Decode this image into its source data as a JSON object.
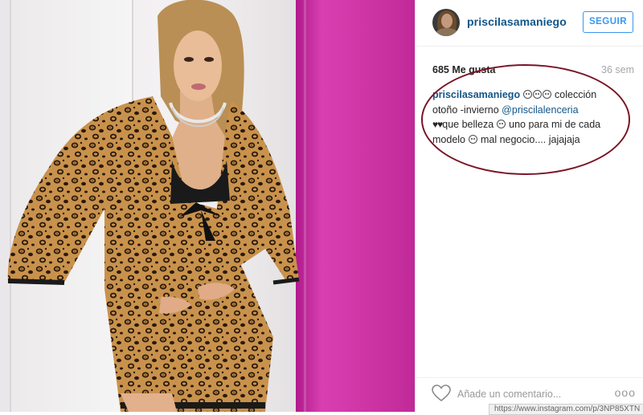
{
  "post": {
    "photo_alt": "photo",
    "header": {
      "username": "priscilasamaniego",
      "follow_label": "SEGUIR"
    },
    "stats": {
      "likes": "685 Me gusta",
      "time": "36 sem"
    },
    "caption": {
      "username": "priscilasamaniego",
      "line1_text": " colección",
      "line2_text": "otoño -invierno ",
      "mention": "@priscilalenceria",
      "line3_hearts": "♥♥",
      "line3_text_a": "que belleza ",
      "line3_text_b": " uno para mi de cada",
      "line4_text_a": "modelo ",
      "line4_text_b": " mal negocio.... jajajaja"
    },
    "footer": {
      "comment_placeholder": "Añade un comentario...",
      "more_label": "ooo"
    },
    "url_strip": "https://www.instagram.com/p/3NP85XTN"
  },
  "colors": {
    "username": "#125688",
    "follow": "#3897f0",
    "annotation_ellipse": "#7b1426",
    "wall_pink": "#d83fb0",
    "wall_light": "#f3f1f2"
  },
  "icons": {
    "like": "heart-icon",
    "more": "more-options-icon",
    "emoji": "smiley-emoji-icon"
  }
}
